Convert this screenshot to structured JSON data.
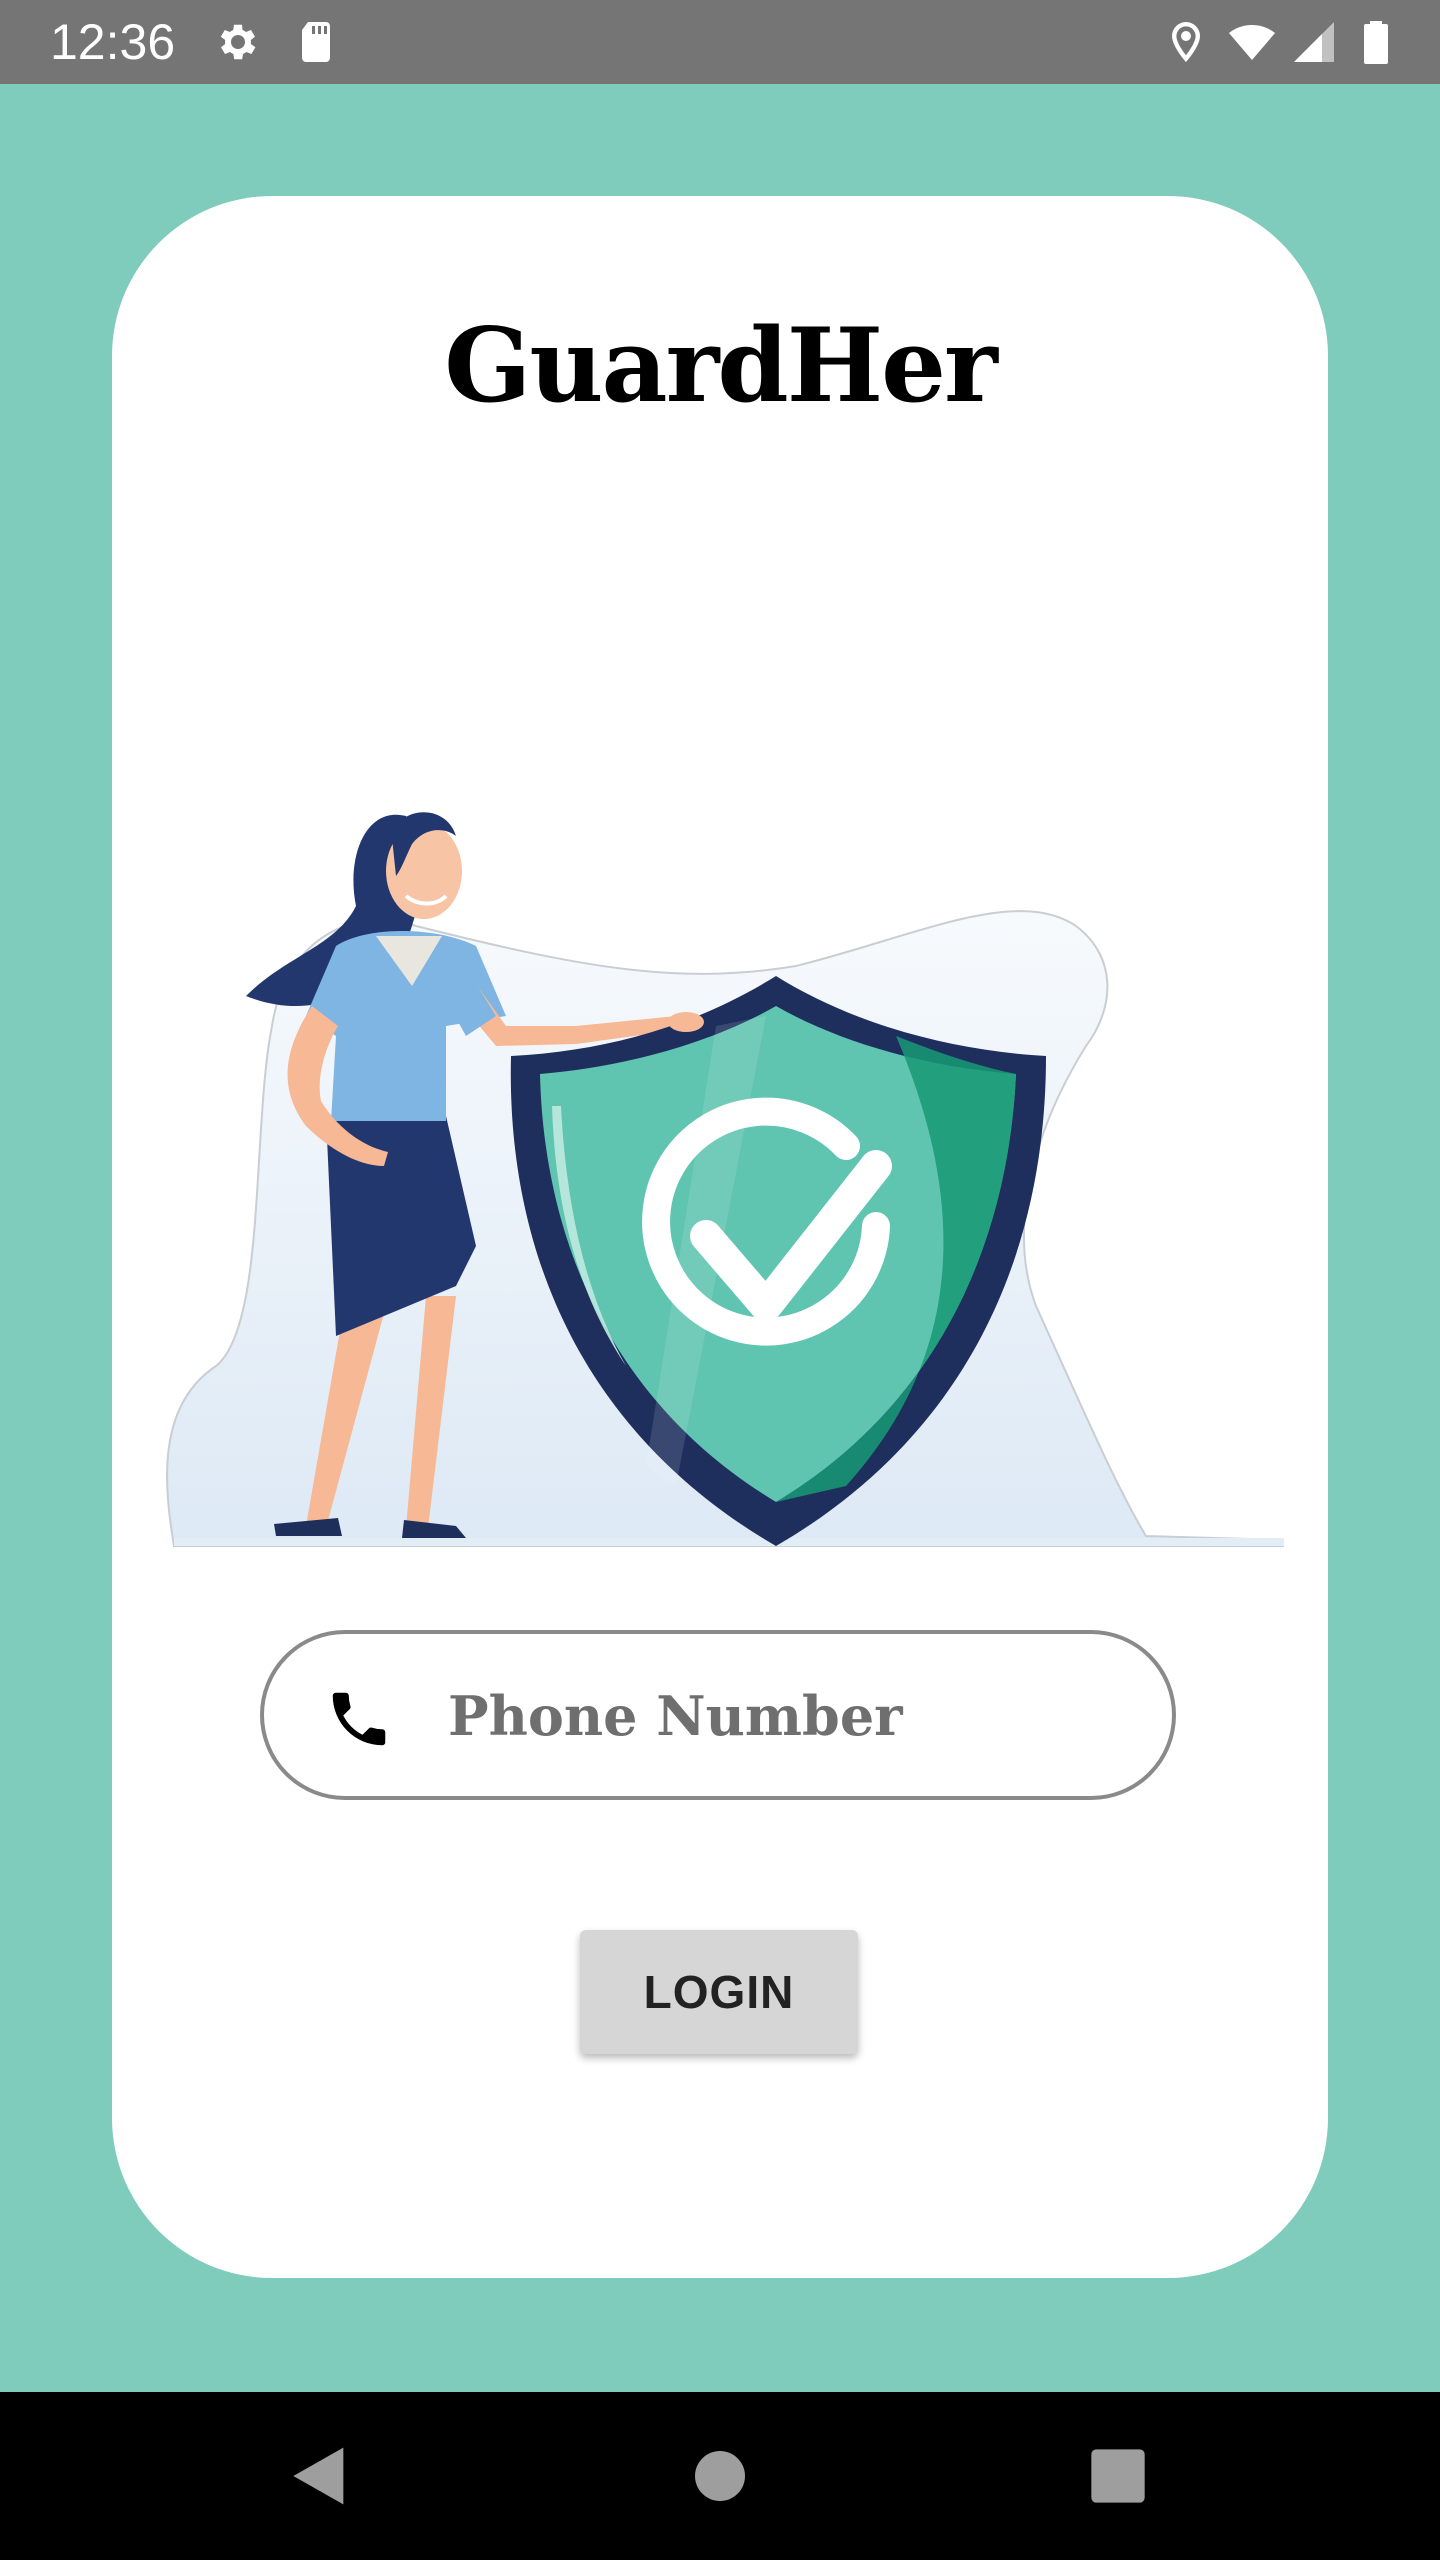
{
  "status_bar": {
    "time": "12:36",
    "left_icons": [
      "gear-icon",
      "sd-card-icon"
    ],
    "right_icons": [
      "location-icon",
      "wifi-icon",
      "cell-signal-icon",
      "battery-icon"
    ]
  },
  "app": {
    "title": "GuardHer",
    "illustration": "woman-with-security-shield-illustration"
  },
  "login_form": {
    "phone_placeholder": "Phone Number",
    "phone_value": "",
    "phone_icon": "phone-icon",
    "login_label": "LOGIN"
  },
  "nav_bar": {
    "buttons": [
      "back-icon",
      "home-icon",
      "recents-icon"
    ]
  },
  "colors": {
    "background": "#7fcbbc",
    "card": "#ffffff",
    "status_bar": "#757575",
    "button": "#d6d6d6",
    "shield_teal": "#5fc4b0",
    "shield_navy": "#1e2f5e"
  }
}
